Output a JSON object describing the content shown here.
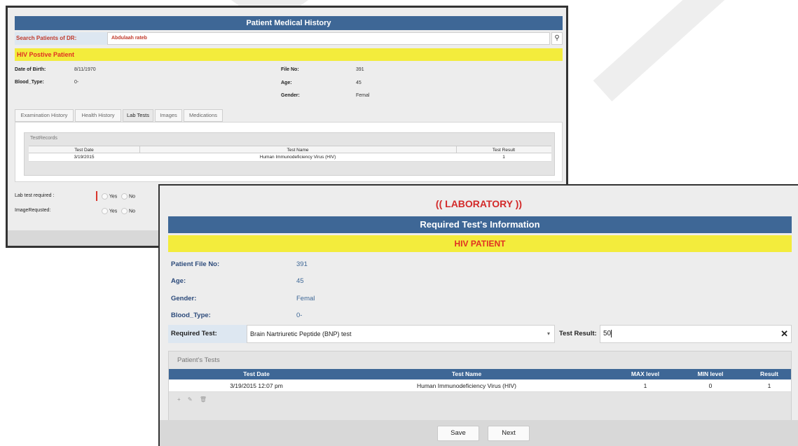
{
  "back_window": {
    "title": "Patient Medical History",
    "search": {
      "label": "Search Patients of DR:",
      "value": "Abdulaah rateb",
      "icon": "search-icon"
    },
    "banner": "HIV Postive Patient",
    "fields": {
      "dob_label": "Date of Birth:",
      "dob_value": "8/11/1970",
      "blood_label": "Blood_Type:",
      "blood_value": "0-",
      "file_label": "File No:",
      "file_value": "391",
      "age_label": "Age:",
      "age_value": "45",
      "gender_label": "Gender:",
      "gender_value": "Femal"
    },
    "tabs": [
      "Examination History",
      "Health History",
      "Lab Tests",
      "Images",
      "Medications"
    ],
    "active_tab": "Lab Tests",
    "grid": {
      "title": "TestRecords",
      "columns": [
        "Test Date",
        "Test Name",
        "Test Result"
      ],
      "rows": [
        [
          "3/19/2015",
          "Human Immunodeficiency Virus (HIV)",
          "1"
        ]
      ]
    },
    "lab_required_label": "Lab test required :",
    "image_requested_label": "ImageRequsted:",
    "yes_label": "Yes",
    "no_label": "No"
  },
  "front_window": {
    "heading": "(( LABORATORY ))",
    "title": "Required Test's Information",
    "banner": "HIV PATIENT",
    "fields": {
      "file_label": "Patient File No:",
      "file_value": "391",
      "age_label": "Age:",
      "age_value": "45",
      "gender_label": "Gender:",
      "gender_value": "Femal",
      "blood_label": "Blood_Type:",
      "blood_value": "0-"
    },
    "required_test": {
      "label": "Required Test:",
      "selected": "Brain Nartriuretic Peptide (BNP) test",
      "arrow": "▾"
    },
    "test_result": {
      "label": "Test Result:",
      "value": "50",
      "clear": "✕"
    },
    "grid": {
      "title": "Patient's Tests",
      "columns": [
        "Test Date",
        "Test Name",
        "MAX level",
        "MIN level",
        "Result"
      ],
      "rows": [
        [
          "3/19/2015 12:07 pm",
          "Human Immunodeficiency Virus (HIV)",
          "1",
          "0",
          "1"
        ]
      ],
      "tools": {
        "add": "+",
        "edit": "✎",
        "delete": "🗑"
      }
    },
    "buttons": {
      "save": "Save",
      "next": "Next"
    }
  },
  "colors": {
    "header_blue": "#3e6796",
    "banner_yellow": "#f3ec3c",
    "alert_red": "#e03022"
  }
}
